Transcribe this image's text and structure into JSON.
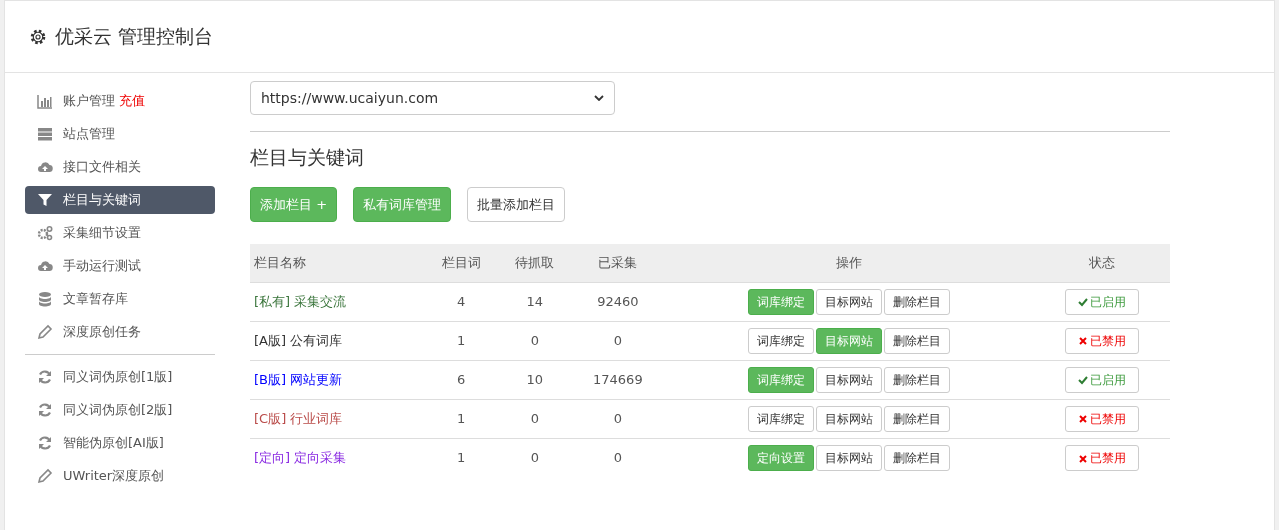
{
  "header": {
    "title": "优采云 管理控制台"
  },
  "sidebar": {
    "items": [
      {
        "kind": "chart",
        "label": "账户管理",
        "extra": "充值",
        "selected": false
      },
      {
        "kind": "server",
        "label": "站点管理",
        "selected": false
      },
      {
        "kind": "cloud",
        "label": "接口文件相关",
        "selected": false
      },
      {
        "kind": "filter",
        "label": "栏目与关键词",
        "selected": true
      },
      {
        "kind": "gears",
        "label": "采集细节设置",
        "selected": false
      },
      {
        "kind": "cloud",
        "label": "手动运行测试",
        "selected": false
      },
      {
        "kind": "database",
        "label": "文章暂存库",
        "selected": false
      },
      {
        "kind": "pencil",
        "label": "深度原创任务",
        "selected": false
      }
    ],
    "tools": [
      {
        "kind": "refresh",
        "label": "同义词伪原创[1版]"
      },
      {
        "kind": "refresh",
        "label": "同义词伪原创[2版]"
      },
      {
        "kind": "refresh",
        "label": "智能伪原创[AI版]"
      },
      {
        "kind": "pencil",
        "label": "UWriter深度原创"
      }
    ]
  },
  "site_select": {
    "value": "https://www.ucaiyun.com"
  },
  "section_title": "栏目与关键词",
  "actions": [
    {
      "label": "添加栏目 +",
      "kind": "primary"
    },
    {
      "label": "私有词库管理",
      "kind": "primary"
    },
    {
      "label": "批量添加栏目",
      "kind": "default"
    }
  ],
  "table": {
    "columns": [
      "栏目名称",
      "栏目词",
      "待抓取",
      "已采集",
      "操作",
      "状态"
    ],
    "rows": [
      {
        "tag": "[私有]",
        "name": "采集交流",
        "color": "#3c763d",
        "words": "4",
        "pending": "14",
        "collected": "92460",
        "buttons": [
          {
            "label": "词库绑定",
            "highlighted": true
          },
          {
            "label": "目标网站",
            "highlighted": false
          },
          {
            "label": "删除栏目",
            "highlighted": false
          }
        ],
        "enabled": true,
        "status": "已启用"
      },
      {
        "tag": "[A版]",
        "name": "公有词库",
        "color": "#333333",
        "words": "1",
        "pending": "0",
        "collected": "0",
        "buttons": [
          {
            "label": "词库绑定",
            "highlighted": false
          },
          {
            "label": "目标网站",
            "highlighted": true
          },
          {
            "label": "删除栏目",
            "highlighted": false
          }
        ],
        "enabled": false,
        "status": "已禁用"
      },
      {
        "tag": "[B版]",
        "name": "网站更新",
        "color": "#0000ff",
        "words": "6",
        "pending": "10",
        "collected": "174669",
        "buttons": [
          {
            "label": "词库绑定",
            "highlighted": true
          },
          {
            "label": "目标网站",
            "highlighted": false
          },
          {
            "label": "删除栏目",
            "highlighted": false
          }
        ],
        "enabled": true,
        "status": "已启用"
      },
      {
        "tag": "[C版]",
        "name": "行业词库",
        "color": "#b94a48",
        "words": "1",
        "pending": "0",
        "collected": "0",
        "buttons": [
          {
            "label": "词库绑定",
            "highlighted": false
          },
          {
            "label": "目标网站",
            "highlighted": false
          },
          {
            "label": "删除栏目",
            "highlighted": false
          }
        ],
        "enabled": false,
        "status": "已禁用"
      },
      {
        "tag": "[定向]",
        "name": "定向采集",
        "color": "#8a2be2",
        "words": "1",
        "pending": "0",
        "collected": "0",
        "buttons": [
          {
            "label": "定向设置",
            "highlighted": true
          },
          {
            "label": "目标网站",
            "highlighted": false
          },
          {
            "label": "删除栏目",
            "highlighted": false
          }
        ],
        "enabled": false,
        "status": "已禁用"
      }
    ]
  }
}
